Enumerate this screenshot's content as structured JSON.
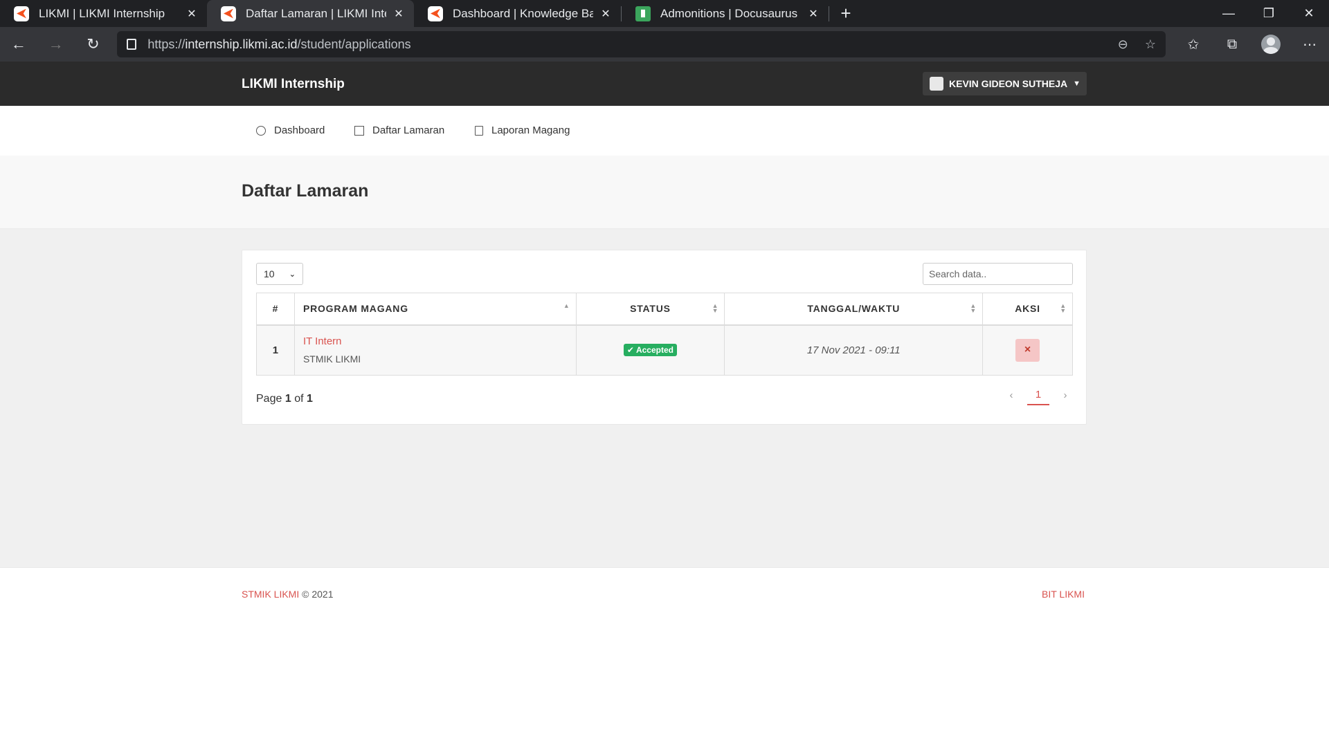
{
  "browser": {
    "tabs": [
      {
        "title": "LIKMI | LIKMI Internship",
        "favicon": "likmi-icon"
      },
      {
        "title": "Daftar Lamaran | LIKMI Internship",
        "favicon": "likmi-icon",
        "active": true
      },
      {
        "title": "Dashboard | Knowledge Base LIKMI",
        "favicon": "likmi-icon"
      },
      {
        "title": "Admonitions | Docusaurus",
        "favicon": "docusaurus-icon"
      }
    ],
    "url_prefix": "https://",
    "url_domain": "internship.likmi.ac.id",
    "url_path": "/student/applications"
  },
  "app": {
    "brand": "LIKMI Internship",
    "user_name": "KEVIN GIDEON SUTHEJA",
    "nav": [
      {
        "label": "Dashboard",
        "icon": "compass-icon"
      },
      {
        "label": "Daftar Lamaran",
        "icon": "clipboard-icon"
      },
      {
        "label": "Laporan Magang",
        "icon": "book-icon"
      }
    ],
    "page_title": "Daftar Lamaran"
  },
  "table_controls": {
    "per_page": "10",
    "search_placeholder": "Search data.."
  },
  "table": {
    "headers": [
      "#",
      "PROGRAM MAGANG",
      "STATUS",
      "TANGGAL/WAKTU",
      "AKSI"
    ],
    "rows": [
      {
        "num": "1",
        "program": "IT Intern",
        "organization": "STMIK LIKMI",
        "status": "Accepted",
        "datetime": "17 Nov 2021 - 09:11",
        "action": "×"
      }
    ]
  },
  "pagination": {
    "page_label": "Page",
    "current": "1",
    "of_label": "of",
    "total": "1",
    "active_page": "1"
  },
  "footer": {
    "brand": "STMIK LIKMI",
    "copyright": "© 2021",
    "right_link": "BIT LIKMI"
  },
  "colors": {
    "accent": "#d9534f",
    "success": "#27ae60",
    "header_bg": "#2b2b2b"
  }
}
